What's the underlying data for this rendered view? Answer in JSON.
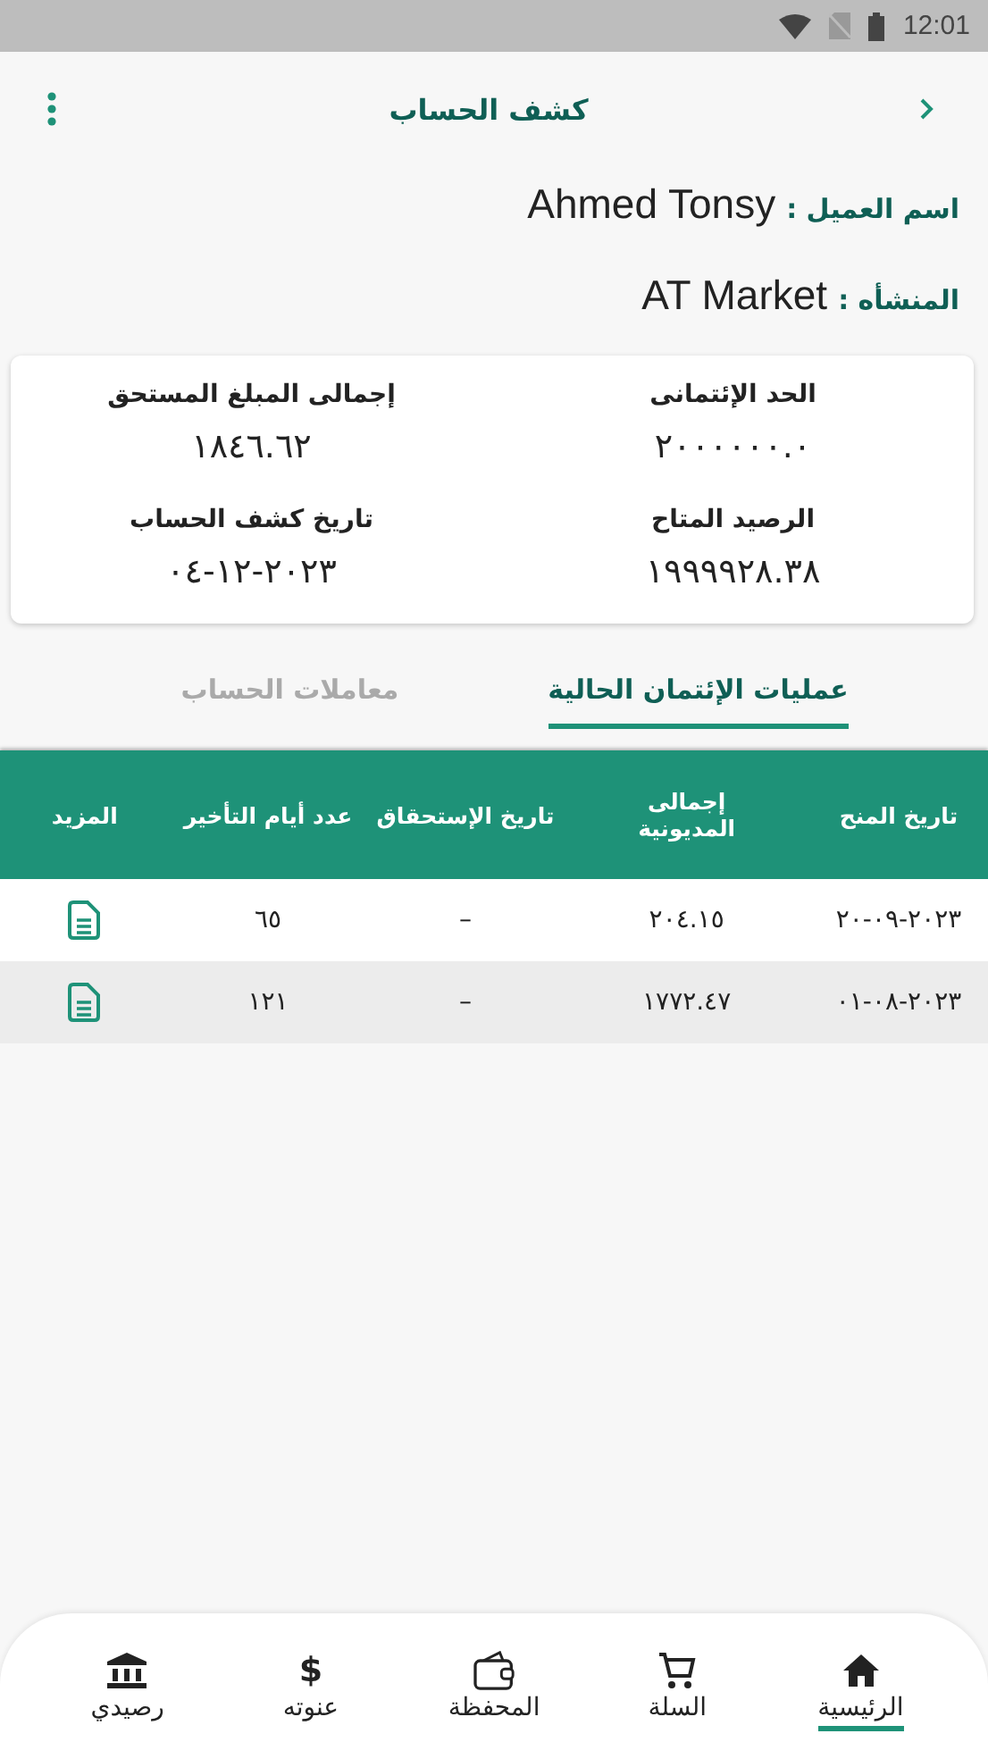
{
  "status_bar": {
    "time": "12:01"
  },
  "header": {
    "title": "كشف الحساب"
  },
  "customer": [
    {
      "label": "اسم العميل :",
      "value": "Ahmed Tonsy"
    },
    {
      "label": "المنشأه :",
      "value": "AT Market"
    }
  ],
  "summary": [
    {
      "label": "الحد الإئتمانى",
      "value": "٢٠٠٠٠٠٠.٠"
    },
    {
      "label": "إجمالى المبلغ المستحق",
      "value": "١٨٤٦.٦٢"
    },
    {
      "label": "الرصيد المتاح",
      "value": "١٩٩٩٩٢٨.٣٨"
    },
    {
      "label": "تاريخ كشف الحساب",
      "value": "٢٠٢٣-١٢-٠٤"
    }
  ],
  "tabs": [
    {
      "label": "عمليات الإئتمان الحالية",
      "selected": true
    },
    {
      "label": "معاملات الحساب",
      "selected": false
    }
  ],
  "table": {
    "columns": [
      "تاريخ المنح",
      "إجمالى المديونية",
      "تاريخ الإستحقاق",
      "عدد أيام التأخير",
      "المزيد"
    ],
    "rows": [
      {
        "cells": [
          "٢٠٢٣-٠٩-٢٠",
          "٢٠٤.١٥",
          "–",
          "٦٥"
        ]
      },
      {
        "cells": [
          "٢٠٢٣-٠٨-٠١",
          "١٧٧٢.٤٧",
          "–",
          "١٢١"
        ]
      }
    ]
  },
  "bottom_nav": [
    {
      "label": "الرئيسية",
      "kind": "home",
      "selected": true
    },
    {
      "label": "السلة",
      "kind": "cart",
      "selected": false
    },
    {
      "label": "المحفظة",
      "kind": "wallet",
      "selected": false
    },
    {
      "label": "عنوته",
      "kind": "glyph",
      "glyph": "$",
      "selected": false
    },
    {
      "label": "رصيدي",
      "kind": "bank",
      "selected": false
    }
  ]
}
